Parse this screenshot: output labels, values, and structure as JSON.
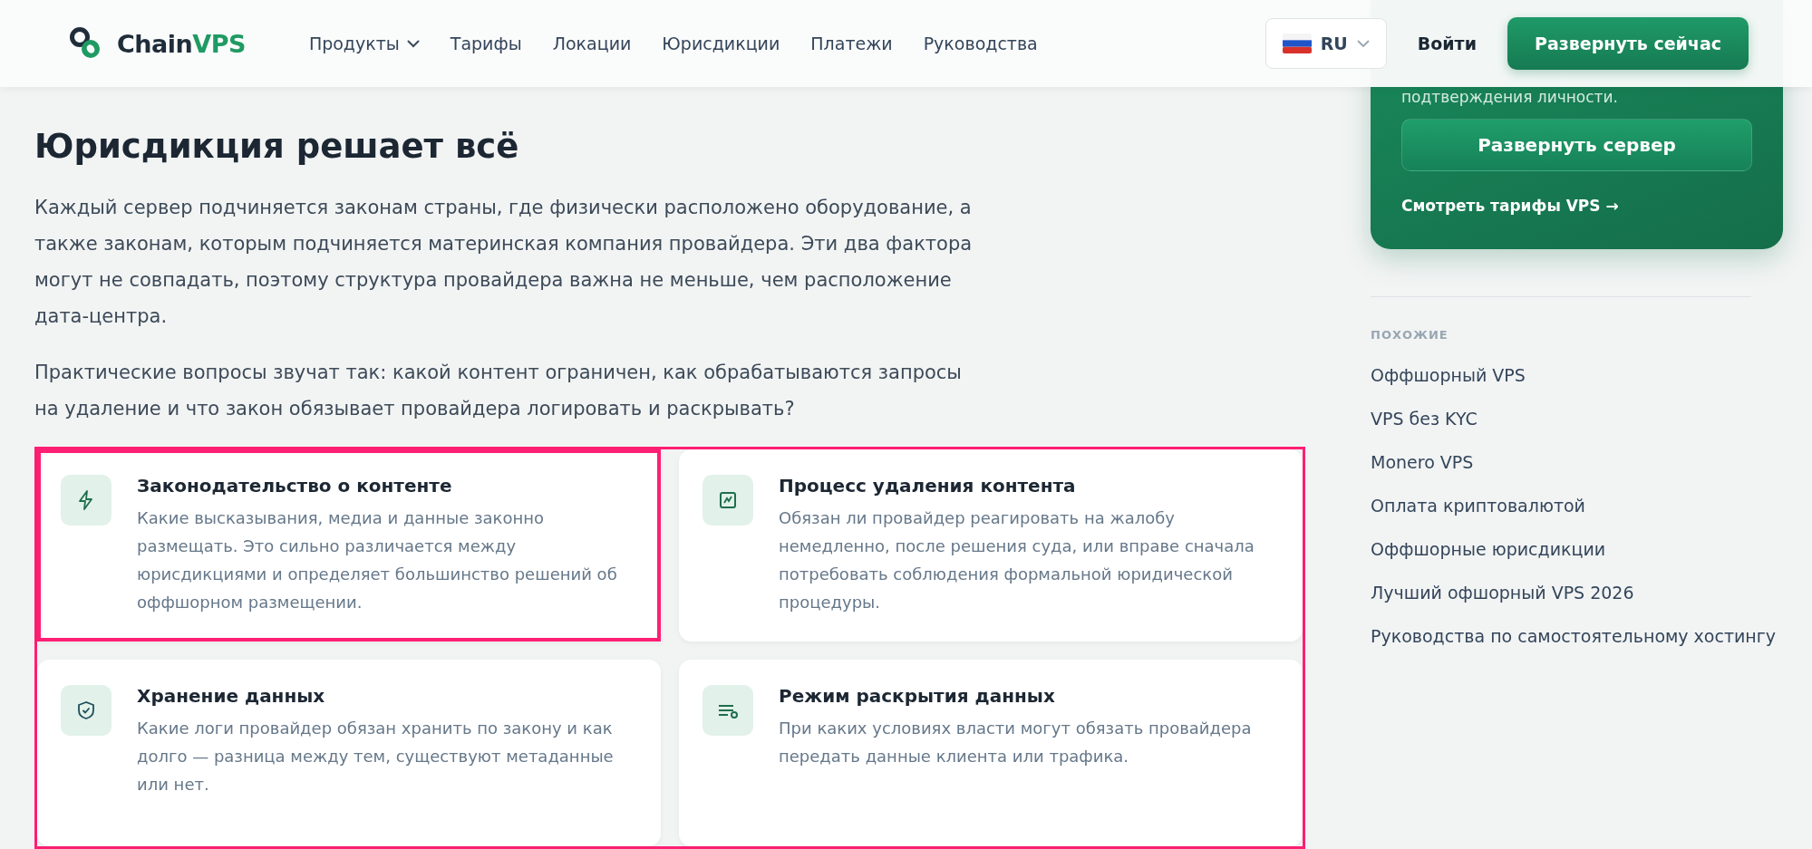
{
  "header": {
    "logo": {
      "name_part": "Chain",
      "accent_part": "VPS"
    },
    "nav": [
      {
        "label": "Продукты",
        "has_menu": true
      },
      {
        "label": "Тарифы",
        "has_menu": false
      },
      {
        "label": "Локации",
        "has_menu": false
      },
      {
        "label": "Юрисдикции",
        "has_menu": false
      },
      {
        "label": "Платежи",
        "has_menu": false
      },
      {
        "label": "Руководства",
        "has_menu": false
      }
    ],
    "language": "RU",
    "login": "Войти",
    "cta": "Развернуть сейчас"
  },
  "article": {
    "title": "Юрисдикция решает всё",
    "paragraphs": [
      "Каждый сервер подчиняется законам страны, где физически расположено оборудование, а также законам, которым подчиняется материнская компания провайдера. Эти два фактора могут не совпадать, поэтому структура провайдера важна не меньше, чем расположение дата-центра.",
      "Практические вопросы звучат так: какой контент ограничен, как обрабатываются запросы на удаление и что закон обязывает провайдера логировать и раскрывать?"
    ],
    "cards": [
      {
        "kind": "bolt",
        "title": "Законодательство о контенте",
        "text": "Какие высказывания, медиа и данные законно размещать. Это сильно различается между юрисдикциями и определяет большинство решений об оффшорном размещении.",
        "highlighted": true
      },
      {
        "kind": "chart",
        "title": "Процесс удаления контента",
        "text": "Обязан ли провайдер реагировать на жалобу немедленно, после решения суда, или вправе сначала потребовать соблюдения формальной юридической процедуры.",
        "highlighted": false
      },
      {
        "kind": "shield",
        "title": "Хранение данных",
        "text": "Какие логи провайдер обязан хранить по закону и как долго — разница между тем, существуют метаданные или нет.",
        "highlighted": false
      },
      {
        "kind": "list",
        "title": "Режим раскрытия данных",
        "text": "При каких условиях власти могут обязать провайдера передать данные клиента или трафика.",
        "highlighted": false
      }
    ]
  },
  "sidebar": {
    "promo": {
      "text": "подтверждения личности.",
      "button": "Развернуть сервер",
      "link": "Смотреть тарифы VPS →"
    },
    "related_heading": "ПОХОЖИЕ",
    "related": [
      "Оффшорный VPS",
      "VPS без KYC",
      "Monero VPS",
      "Оплата криптовалютой",
      "Оффшорные юрисдикции",
      "Лучший офшорный VPS 2026",
      "Руководства по самостоятельному хостингу"
    ]
  }
}
